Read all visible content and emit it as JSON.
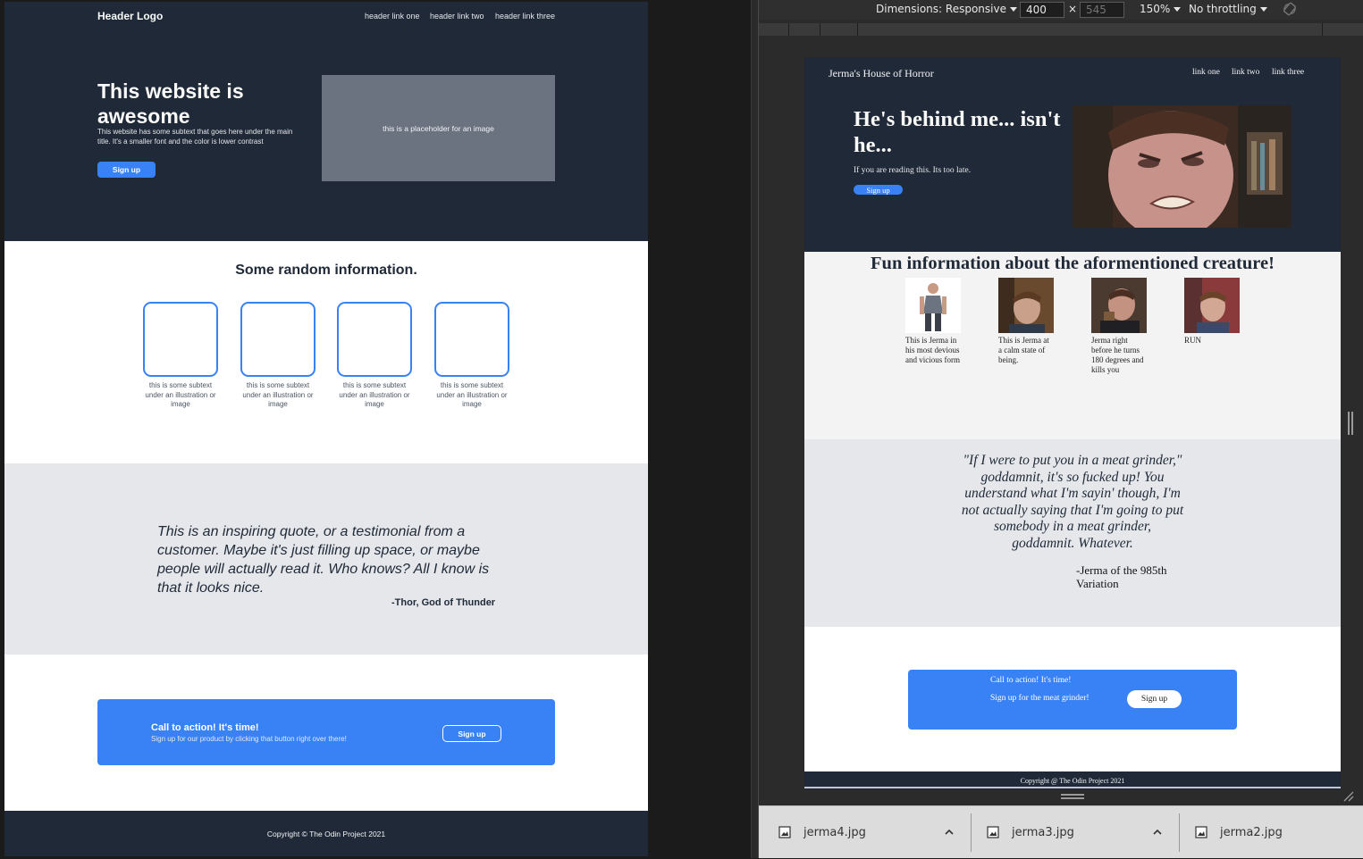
{
  "mockup": {
    "header_logo": "Header Logo",
    "nav_links": [
      "header link one",
      "header link two",
      "header link three"
    ],
    "hero_title": "This website is awesome",
    "hero_subtext": "This website has some subtext that goes here under the main title.  It's a smaller font and the color is lower contrast",
    "hero_button": "Sign up",
    "image_placeholder": "this is a placeholder for an image",
    "info_title": "Some random information.",
    "card_caption": "this is some subtext under an illustration or image",
    "quote": "This is an inspiring quote, or a testimonial from a customer.  Maybe it's just filling up space, or maybe people will actually read it. Who knows?  All I know is that it looks nice.",
    "quote_author": "-Thor, God of Thunder",
    "cta_title": "Call to action! It's time!",
    "cta_subtext": "Sign up for our product by clicking that button right over there!",
    "cta_button": "Sign up",
    "footer": "Copyright  ©  The Odin Project 2021",
    "colors": {
      "dark": "#1f2937",
      "accent": "#3882f6",
      "gray_band": "#e5e7eb",
      "placeholder": "#6b7280"
    }
  },
  "devtools": {
    "dimensions_label": "Dimensions: Responsive",
    "width": "400",
    "height_placeholder": "545",
    "times": "×",
    "zoom": "150%",
    "throttling": "No throttling",
    "rotate_icon": "rotate-icon"
  },
  "site": {
    "logo": "Jerma's House of Horror",
    "nav_links": [
      "link one",
      "link two",
      "link three"
    ],
    "hero_title": "He's behind me... isn't he...",
    "hero_subtext": "If you are reading this. Its too late.",
    "hero_button": "Sign up",
    "info_title": "Fun information about the aformentioned creature!",
    "cards": [
      {
        "caption": "This is Jerma in his most devious and vicious form"
      },
      {
        "caption": "This is Jerma at a calm state of being."
      },
      {
        "caption": "Jerma right before he turns 180 degrees and kills you"
      },
      {
        "caption": "RUN"
      }
    ],
    "quote": "\"If I were to put you in a meat grinder,\" goddamnit, it's so fucked up! You understand what I'm sayin' though, I'm not actually saying that I'm going to put somebody in a meat grinder, goddamnit. Whatever.",
    "quote_author": "-Jerma of the 985th Variation",
    "cta_title": "Call to action! It's time!",
    "cta_subtext": "Sign up for the meat grinder!",
    "cta_button": "Sign up",
    "footer": "Copyright @ The Odin Project 2021"
  },
  "downloads": [
    {
      "filename": "jerma4.jpg",
      "icon": "image-file-icon"
    },
    {
      "filename": "jerma3.jpg",
      "icon": "image-file-icon"
    },
    {
      "filename": "jerma2.jpg",
      "icon": "image-file-icon"
    }
  ]
}
